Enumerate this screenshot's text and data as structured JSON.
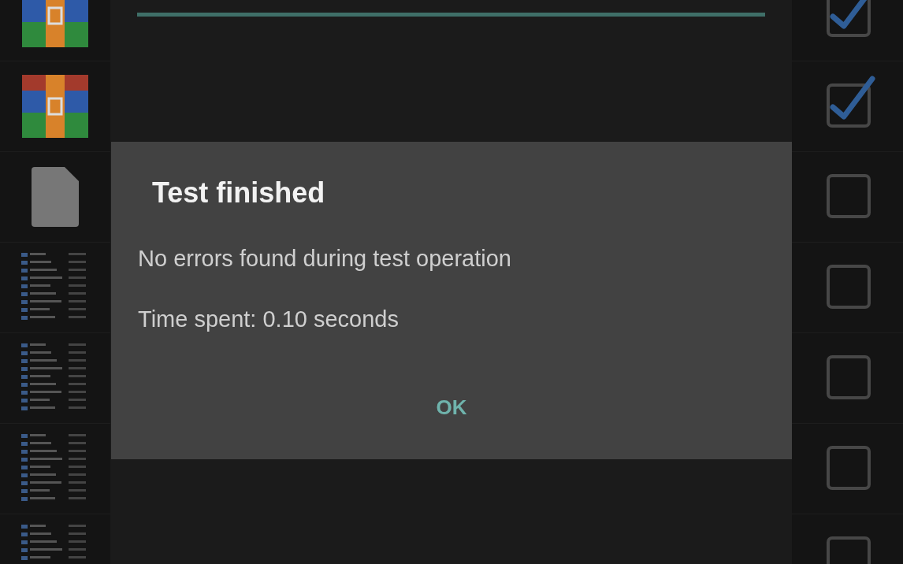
{
  "files": [
    {
      "kind": "archive",
      "checked": true
    },
    {
      "kind": "archive",
      "checked": true
    },
    {
      "kind": "file",
      "checked": false
    },
    {
      "kind": "document",
      "checked": false
    },
    {
      "kind": "document",
      "checked": false
    },
    {
      "kind": "document",
      "checked": false
    },
    {
      "kind": "document",
      "checked": false
    }
  ],
  "progress": {
    "level": 1
  },
  "dialog": {
    "title": "Test finished",
    "message": "No errors found during test operation",
    "time": "Time spent: 0.10 seconds",
    "button": "OK"
  }
}
